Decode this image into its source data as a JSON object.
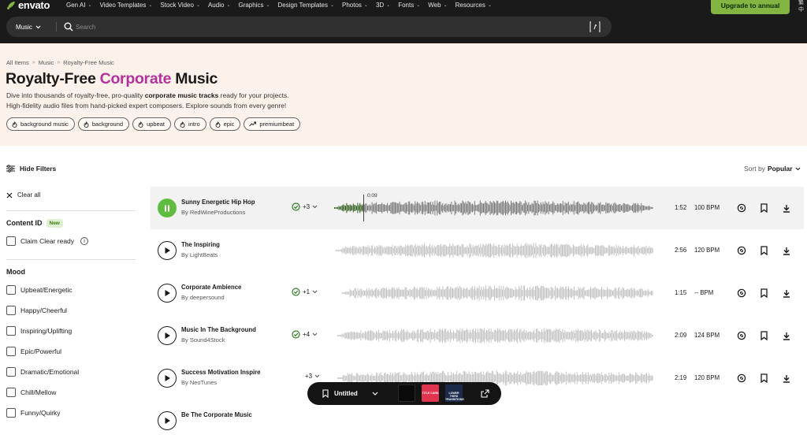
{
  "header": {
    "logo_text": "envato",
    "nav": [
      "Gen AI",
      "Video Templates",
      "Stock Video",
      "Audio",
      "Graphics",
      "Design Templates",
      "Photos",
      "3D",
      "Fonts",
      "Web",
      "Resources"
    ],
    "upgrade_label": "Upgrade to annual",
    "lang_text": "繁\n中"
  },
  "search": {
    "category": "Music",
    "placeholder": "Search"
  },
  "hero": {
    "breadcrumbs": [
      "All Items",
      "Music",
      "Royalty-Free Music"
    ],
    "title_prefix": "Royalty-Free ",
    "title_accent": "Corporate",
    "title_suffix": " Music",
    "desc_1a": "Dive into thousands of royalty-free, pro-quality ",
    "desc_1b": "corporate music tracks",
    "desc_1c": " ready for your projects.",
    "desc_2": "High-fidelity audio files from hand-picked expert composers. Explore sounds from every genre!",
    "tags": [
      {
        "label": "background music",
        "icon": "flame-icon"
      },
      {
        "label": "background",
        "icon": "flame-icon"
      },
      {
        "label": "upbeat",
        "icon": "flame-icon"
      },
      {
        "label": "intro",
        "icon": "flame-icon"
      },
      {
        "label": "epic",
        "icon": "flame-icon"
      },
      {
        "label": "premiumbeat",
        "icon": "trending-icon"
      }
    ]
  },
  "filters": {
    "hide_label": "Hide Filters",
    "clear_label": "Clear all",
    "content_id_title": "Content ID",
    "new_badge": "New",
    "claim_label": "Claim Clear ready",
    "mood_title": "Mood",
    "moods": [
      "Upbeat/Energetic",
      "Happy/Cheerful",
      "Inspiring/Uplifting",
      "Epic/Powerful",
      "Dramatic/Emotional",
      "Chill/Mellow",
      "Funny/Quirky"
    ]
  },
  "sort": {
    "prefix": "Sort by",
    "value": "Popular"
  },
  "tracks": [
    {
      "name": "Sunny Energetic Hip Hop",
      "author": "By RedWineProductions",
      "variants": "+3",
      "duration": "1:52",
      "bpm": "100 BPM",
      "playing": true,
      "time": "0:09",
      "progress": 0.09
    },
    {
      "name": "The Inspiring",
      "author": "By LightBeats",
      "variants": "",
      "duration": "2:56",
      "bpm": "120 BPM",
      "playing": false
    },
    {
      "name": "Corporate Ambience",
      "author": "By deepersound",
      "variants": "+1",
      "duration": "1:15",
      "bpm": "-- BPM",
      "playing": false
    },
    {
      "name": "Music In The Background",
      "author": "By Sound4Stock",
      "variants": "+4",
      "duration": "2:09",
      "bpm": "124 BPM",
      "playing": false
    },
    {
      "name": "Success Motivation Inspire",
      "author": "By NeoTunes",
      "variants": "+3",
      "duration": "2:19",
      "bpm": "120 BPM",
      "playing": false
    },
    {
      "name": "Be The Corporate Music",
      "author": "",
      "variants": "",
      "duration": "",
      "bpm": "",
      "playing": false
    }
  ],
  "floating_bar": {
    "label": "Untitled",
    "thumbs": [
      "",
      "TITLE CARD",
      "LOWER THIRD TRANSITIONS"
    ]
  },
  "colors": {
    "accent_purple": "#b4329c",
    "brand_green": "#82b541",
    "play_green": "#5ebd3e",
    "hero_bg": "#fdf2ea"
  }
}
